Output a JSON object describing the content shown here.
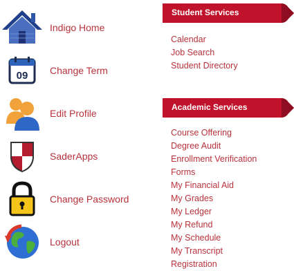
{
  "nav": [
    {
      "label": "Indigo Home",
      "icon": "house-icon"
    },
    {
      "label": "Change Term",
      "icon": "calendar-icon",
      "icon_text": "09"
    },
    {
      "label": "Edit Profile",
      "icon": "people-icon"
    },
    {
      "label": "SaderApps",
      "icon": "shield-icon"
    },
    {
      "label": "Change Password",
      "icon": "padlock-icon"
    },
    {
      "label": "Logout",
      "icon": "globe-icon"
    }
  ],
  "student_services": {
    "title": "Student Services",
    "links": [
      "Calendar",
      "Job Search",
      "Student Directory"
    ]
  },
  "academic_services": {
    "title": "Academic Services",
    "links": [
      "Course Offering",
      "Degree Audit",
      "Enrollment Verification",
      "Forms",
      "My Financial Aid",
      "My Grades",
      "My Ledger",
      "My Refund",
      "My Schedule",
      "My Transcript",
      "Registration"
    ]
  },
  "colors": {
    "accent": "#b8323c",
    "header_bg": "#c0122b",
    "header_dark": "#8e0d20"
  }
}
